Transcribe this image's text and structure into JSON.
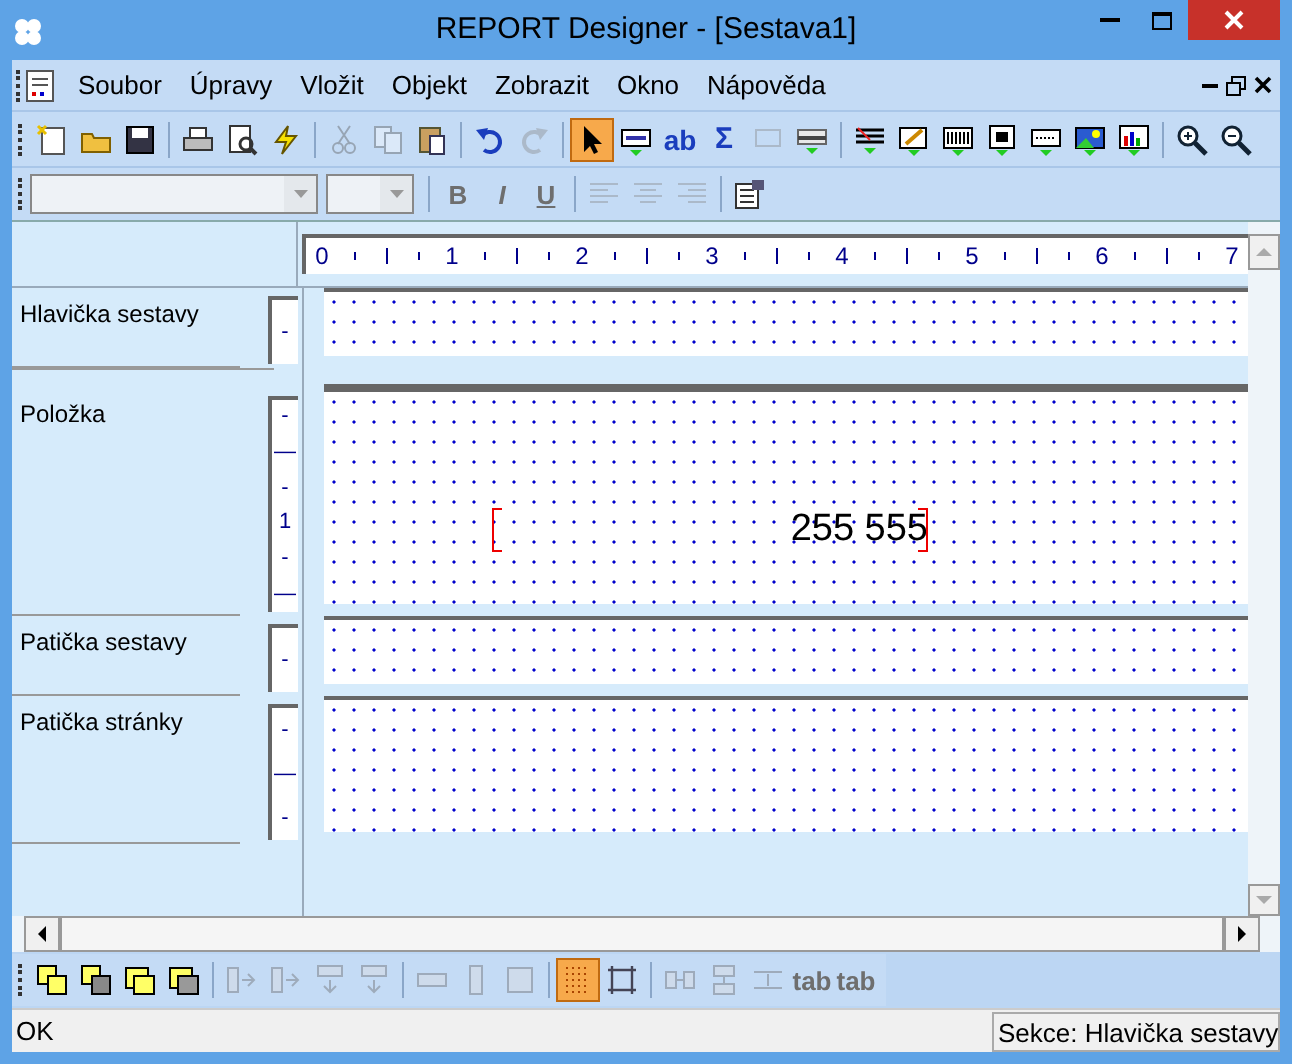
{
  "window": {
    "title": "REPORT Designer - [Sestava1]"
  },
  "menu": [
    {
      "label": "Soubor"
    },
    {
      "label": "Úpravy"
    },
    {
      "label": "Vložit"
    },
    {
      "label": "Objekt"
    },
    {
      "label": "Zobrazit"
    },
    {
      "label": "Okno"
    },
    {
      "label": "Nápověda"
    }
  ],
  "toolbar": [
    [
      {
        "kind": "new",
        "disabled": false,
        "selected": false
      },
      {
        "kind": "open",
        "disabled": false,
        "selected": false
      },
      {
        "kind": "save",
        "disabled": false,
        "selected": false
      }
    ],
    [
      {
        "kind": "print",
        "disabled": false,
        "selected": false
      },
      {
        "kind": "preview",
        "disabled": false,
        "selected": false
      },
      {
        "kind": "lightning",
        "disabled": false,
        "selected": false
      }
    ],
    [
      {
        "kind": "cut",
        "disabled": true,
        "selected": false
      },
      {
        "kind": "copy",
        "disabled": true,
        "selected": false
      },
      {
        "kind": "paste",
        "disabled": false,
        "selected": false
      }
    ],
    [
      {
        "kind": "undo",
        "disabled": false,
        "selected": false
      },
      {
        "kind": "redo",
        "disabled": true,
        "selected": false
      }
    ],
    [
      {
        "kind": "pointer",
        "disabled": false,
        "selected": true
      },
      {
        "kind": "field",
        "disabled": false,
        "selected": false
      },
      {
        "kind": "text",
        "disabled": false,
        "selected": false,
        "label": "ab"
      },
      {
        "kind": "sum",
        "disabled": false,
        "selected": false,
        "label": "Σ"
      },
      {
        "kind": "formula",
        "disabled": true,
        "selected": false
      },
      {
        "kind": "line",
        "disabled": false,
        "selected": false
      }
    ],
    [
      {
        "kind": "band",
        "disabled": false,
        "selected": false
      },
      {
        "kind": "edit",
        "disabled": false,
        "selected": false
      },
      {
        "kind": "barcode",
        "disabled": false,
        "selected": false
      },
      {
        "kind": "box",
        "disabled": false,
        "selected": false
      },
      {
        "kind": "graphic",
        "disabled": false,
        "selected": false
      },
      {
        "kind": "picture",
        "disabled": false,
        "selected": false
      },
      {
        "kind": "chart",
        "disabled": false,
        "selected": false
      }
    ],
    [
      {
        "kind": "zoomin",
        "disabled": false,
        "selected": false
      },
      {
        "kind": "zoomout",
        "disabled": false,
        "selected": false
      }
    ]
  ],
  "format_bar": {
    "font": {
      "disabled": true
    },
    "size": {
      "disabled": true
    },
    "buttons": [
      [
        {
          "kind": "bold",
          "label": "B",
          "disabled": true
        },
        {
          "kind": "italic",
          "label": "I",
          "disabled": true
        },
        {
          "kind": "underline",
          "label": "U",
          "disabled": true
        }
      ],
      [
        {
          "kind": "alignleft",
          "disabled": true
        },
        {
          "kind": "aligncenter",
          "disabled": true
        },
        {
          "kind": "alignright",
          "disabled": true
        }
      ],
      [
        {
          "kind": "properties",
          "disabled": false
        }
      ]
    ]
  },
  "ruler": {
    "labels": [
      "0",
      "1",
      "2",
      "3",
      "4",
      "5",
      "6",
      "7"
    ]
  },
  "sections": [
    {
      "kind": "band",
      "label": "Hlavička sestavy",
      "ruler": [
        "-"
      ]
    },
    {
      "kind": "collapsed"
    },
    {
      "kind": "band",
      "label": "Položka",
      "ruler": [
        "-",
        "—",
        "-",
        "1",
        "-",
        "—"
      ],
      "fields": [
        {
          "text": "255 555"
        }
      ]
    },
    {
      "kind": "band",
      "label": "Patička sestavy",
      "ruler": [
        "-"
      ]
    },
    {
      "kind": "band",
      "label": "Patička stránky",
      "ruler": [
        "-",
        "—",
        "-"
      ]
    }
  ],
  "bottom_toolbar": [
    [
      {
        "kind": "front",
        "disabled": false,
        "selected": false
      },
      {
        "kind": "back",
        "disabled": false,
        "selected": false
      },
      {
        "kind": "forward",
        "disabled": false,
        "selected": false
      },
      {
        "kind": "backward",
        "disabled": false,
        "selected": false
      }
    ],
    [
      {
        "kind": "hspace",
        "disabled": true,
        "selected": false
      },
      {
        "kind": "hspace",
        "disabled": true,
        "selected": false
      },
      {
        "kind": "vspace",
        "disabled": true,
        "selected": false
      },
      {
        "kind": "vspace",
        "disabled": true,
        "selected": false
      }
    ],
    [
      {
        "kind": "hsize",
        "disabled": true,
        "selected": false
      },
      {
        "kind": "vsize",
        "disabled": true,
        "selected": false
      },
      {
        "kind": "bothsize",
        "disabled": true,
        "selected": false
      }
    ],
    [
      {
        "kind": "grid",
        "disabled": false,
        "selected": true
      },
      {
        "kind": "frame",
        "disabled": false,
        "selected": false
      }
    ],
    [
      {
        "kind": "hcenter",
        "disabled": true,
        "selected": false
      },
      {
        "kind": "vcenter",
        "disabled": true,
        "selected": false
      },
      {
        "kind": "distribute",
        "disabled": true,
        "selected": false
      },
      {
        "kind": "tab",
        "disabled": true,
        "selected": false,
        "label": "tab"
      },
      {
        "kind": "tab",
        "disabled": true,
        "selected": false,
        "label": "tab"
      }
    ]
  ],
  "status_bar": {
    "message": "OK",
    "section": "Sekce: Hlavička sestavy"
  }
}
